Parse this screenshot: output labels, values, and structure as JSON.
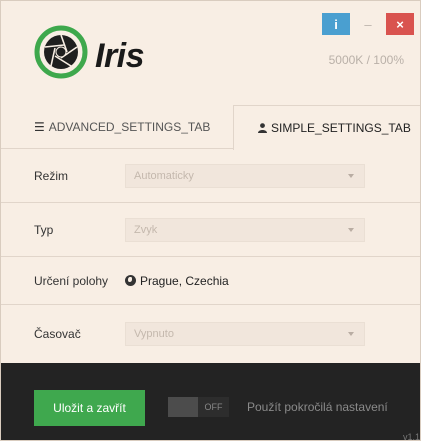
{
  "app": {
    "name": "Iris",
    "status": "5000K / 100%"
  },
  "window_buttons": {
    "info": "i",
    "minimize": "–",
    "close": "×"
  },
  "tabs": [
    {
      "label": "ADVANCED_SETTINGS_TAB",
      "icon": "menu-icon",
      "active": false
    },
    {
      "label": "SIMPLE_SETTINGS_TAB",
      "icon": "user-icon",
      "active": true
    }
  ],
  "form": {
    "mode": {
      "label": "Režim",
      "value": "Automaticky"
    },
    "type": {
      "label": "Typ",
      "value": "Zvyk"
    },
    "location": {
      "label": "Určení polohy",
      "value": "Prague, Czechia"
    },
    "timer": {
      "label": "Časovač",
      "value": "Vypnuto"
    }
  },
  "footer": {
    "save_label": "Uložit a zavřít",
    "toggle_state": "OFF",
    "advanced_label": "Použít pokročilá nastavení",
    "version": "v1.1"
  },
  "colors": {
    "background": "#f8eee4",
    "logo_green": "#3ea84c",
    "info": "#4a9fd0",
    "close": "#d9534f",
    "save": "#3fa84e",
    "footer": "#232323"
  }
}
